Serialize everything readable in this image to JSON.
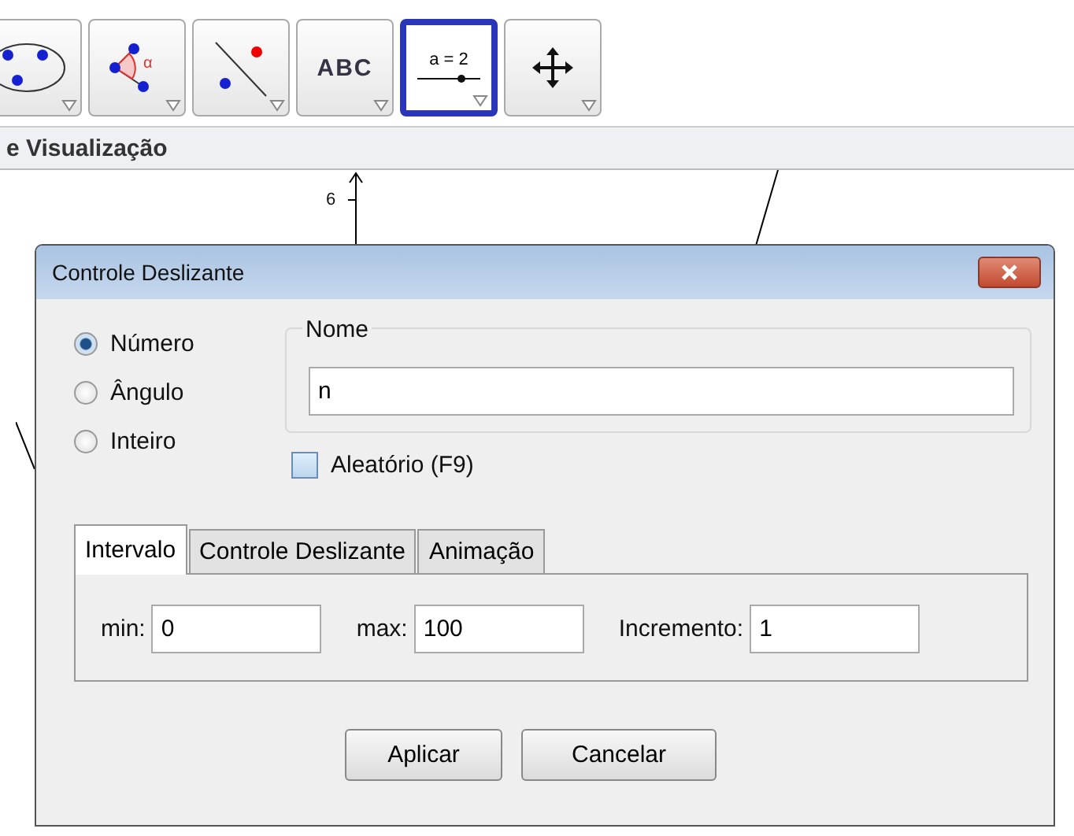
{
  "toolbar": {
    "tools": [
      {
        "kind": "conic",
        "selected": false
      },
      {
        "kind": "angle",
        "label": "α",
        "selected": false
      },
      {
        "kind": "line",
        "selected": false
      },
      {
        "kind": "text",
        "label": "ABC",
        "selected": false
      },
      {
        "kind": "slider",
        "label": "a = 2",
        "selected": true
      },
      {
        "kind": "move",
        "selected": false
      }
    ]
  },
  "view_header": {
    "title": "e Visualização"
  },
  "canvas": {
    "y_tick_label": "6"
  },
  "dialog": {
    "title": "Controle Deslizante",
    "types": [
      {
        "label": "Número",
        "selected": true
      },
      {
        "label": "Ângulo",
        "selected": false
      },
      {
        "label": "Inteiro",
        "selected": false
      }
    ],
    "name_group": {
      "legend": "Nome",
      "value": "n"
    },
    "random": {
      "label": "Aleatório (F9)",
      "checked": false
    },
    "tabs": [
      {
        "label": "Intervalo",
        "selected": true
      },
      {
        "label": "Controle Deslizante",
        "selected": false
      },
      {
        "label": "Animação",
        "selected": false
      }
    ],
    "interval": [
      {
        "label": "min:",
        "value": "0"
      },
      {
        "label": "max:",
        "value": "100"
      },
      {
        "label": "Incremento:",
        "value": "1"
      }
    ],
    "buttons": [
      "Aplicar",
      "Cancelar"
    ]
  }
}
